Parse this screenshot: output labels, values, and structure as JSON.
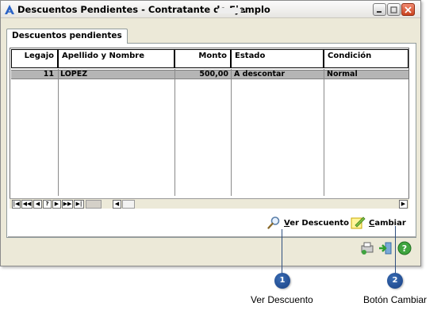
{
  "window": {
    "title": "Descuentos Pendientes - Contratante de Ejemplo",
    "title_suffix": "."
  },
  "tab": {
    "label": "Descuentos pendientes"
  },
  "table": {
    "columns": [
      "Legajo",
      "Apellido y Nombre",
      "Monto",
      "Estado",
      "Condición"
    ],
    "rows": [
      {
        "legajo": "11",
        "nombre": "LOPEZ",
        "monto": "500,00",
        "estado": "A descontar",
        "condicion": "Normal"
      }
    ]
  },
  "navigator": {
    "buttons": [
      "|◀",
      "◀◀",
      "◀",
      "?",
      "▶",
      "▶▶",
      "▶|"
    ]
  },
  "actions": {
    "ver_descuento": {
      "mnemonic": "V",
      "rest": "er Descuento",
      "icon": "magnifier-icon"
    },
    "cambiar": {
      "mnemonic": "C",
      "rest": "ambiar",
      "icon": "edit-note-icon"
    }
  },
  "footer_icons": [
    "print-icon",
    "exit-icon",
    "help-icon"
  ],
  "callouts": [
    {
      "number": "1",
      "label": "Ver Descuento"
    },
    {
      "number": "2",
      "label": "Botón Cambiar"
    }
  ],
  "colors": {
    "selected_row": "#b5b5b5",
    "callout_badge": "#1f4d94",
    "window_bg": "#ece9d8"
  }
}
